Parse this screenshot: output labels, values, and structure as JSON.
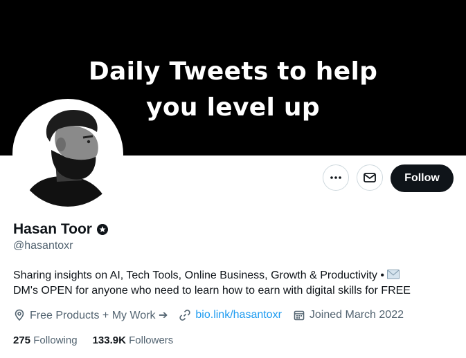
{
  "banner": {
    "line1": "Daily Tweets to help",
    "line2": "you level up"
  },
  "actions": {
    "more_icon": "more-horizontal-icon",
    "message_icon": "envelope-icon",
    "follow_label": "Follow"
  },
  "profile": {
    "display_name": "Hasan Toor",
    "badge_icon": "verified-badge-icon",
    "handle": "@hasantoxr",
    "bio_part1": "Sharing insights on AI, Tech Tools, Online Business, Growth & Productivity •",
    "bio_part2": "DM's OPEN for anyone who need to learn how to earn with digital skills for FREE",
    "bio_emoji_icon": "envelope-emoji-icon",
    "location": "Free Products + My Work ➔",
    "website": "bio.link/hasantoxr",
    "joined": "Joined March 2022"
  },
  "stats": {
    "following_count": "275",
    "following_label": "Following",
    "followers_count": "133.9K",
    "followers_label": "Followers"
  },
  "colors": {
    "banner_bg": "#000000",
    "link": "#1d9bf0",
    "secondary_text": "#536471",
    "follow_button_bg": "#0f1419"
  }
}
